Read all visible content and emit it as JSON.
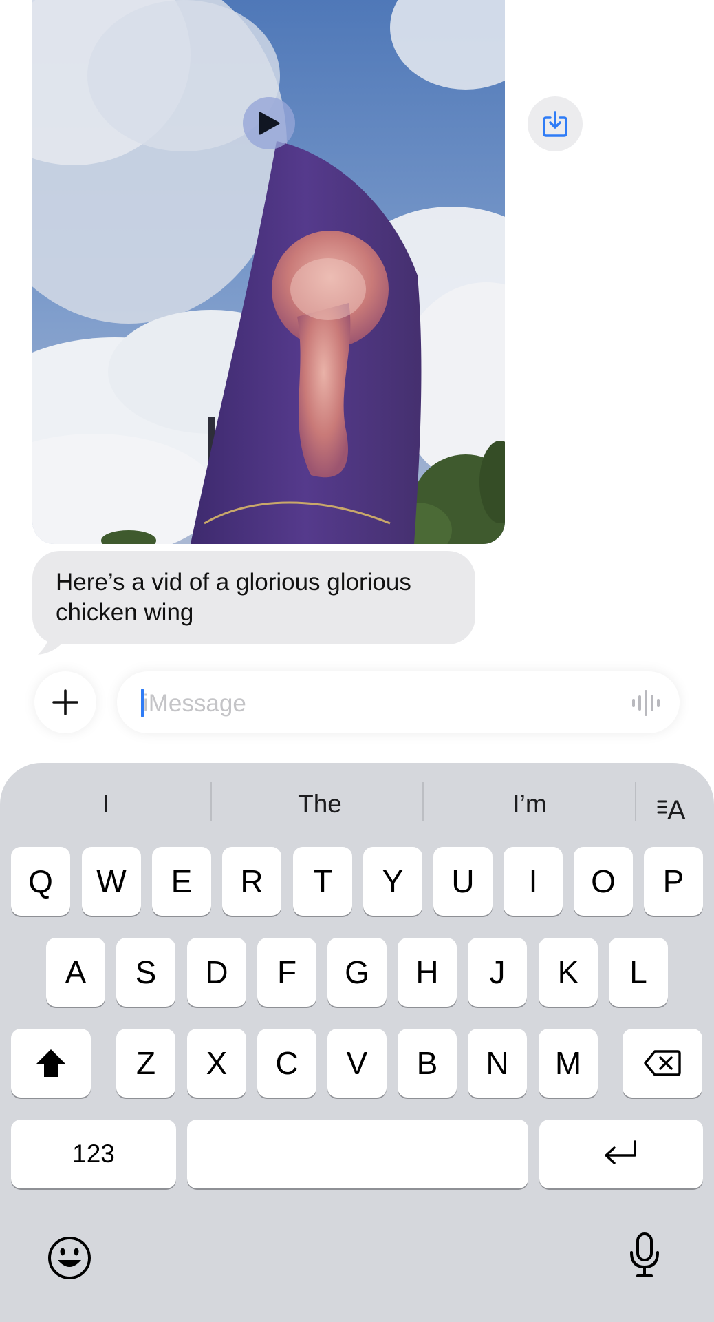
{
  "conversation": {
    "message_text": "Here’s a vid of a glorious glorious chicken wing",
    "video": {
      "media": "video-thumbnail-flag-chicken-wing"
    }
  },
  "icons": {
    "play": "play-icon",
    "save": "save-to-photos-icon",
    "plus": "plus-icon",
    "dictation": "waveform-icon",
    "shift": "shift-icon",
    "delete": "backspace-icon",
    "return": "return-icon",
    "emoji": "emoji-icon",
    "mic": "microphone-icon"
  },
  "input": {
    "placeholder": "iMessage"
  },
  "keyboard": {
    "suggestions": [
      "I",
      "The",
      "I’m"
    ],
    "row1": [
      "Q",
      "W",
      "E",
      "R",
      "T",
      "Y",
      "U",
      "I",
      "O",
      "P"
    ],
    "row2": [
      "A",
      "S",
      "D",
      "F",
      "G",
      "H",
      "J",
      "K",
      "L"
    ],
    "row3": [
      "Z",
      "X",
      "C",
      "V",
      "B",
      "N",
      "M"
    ],
    "numbers_label": "123"
  },
  "colors": {
    "accent": "#2f7cf6",
    "bubble": "#e9e9eb",
    "keyboard_bg": "#d5d7dc"
  }
}
